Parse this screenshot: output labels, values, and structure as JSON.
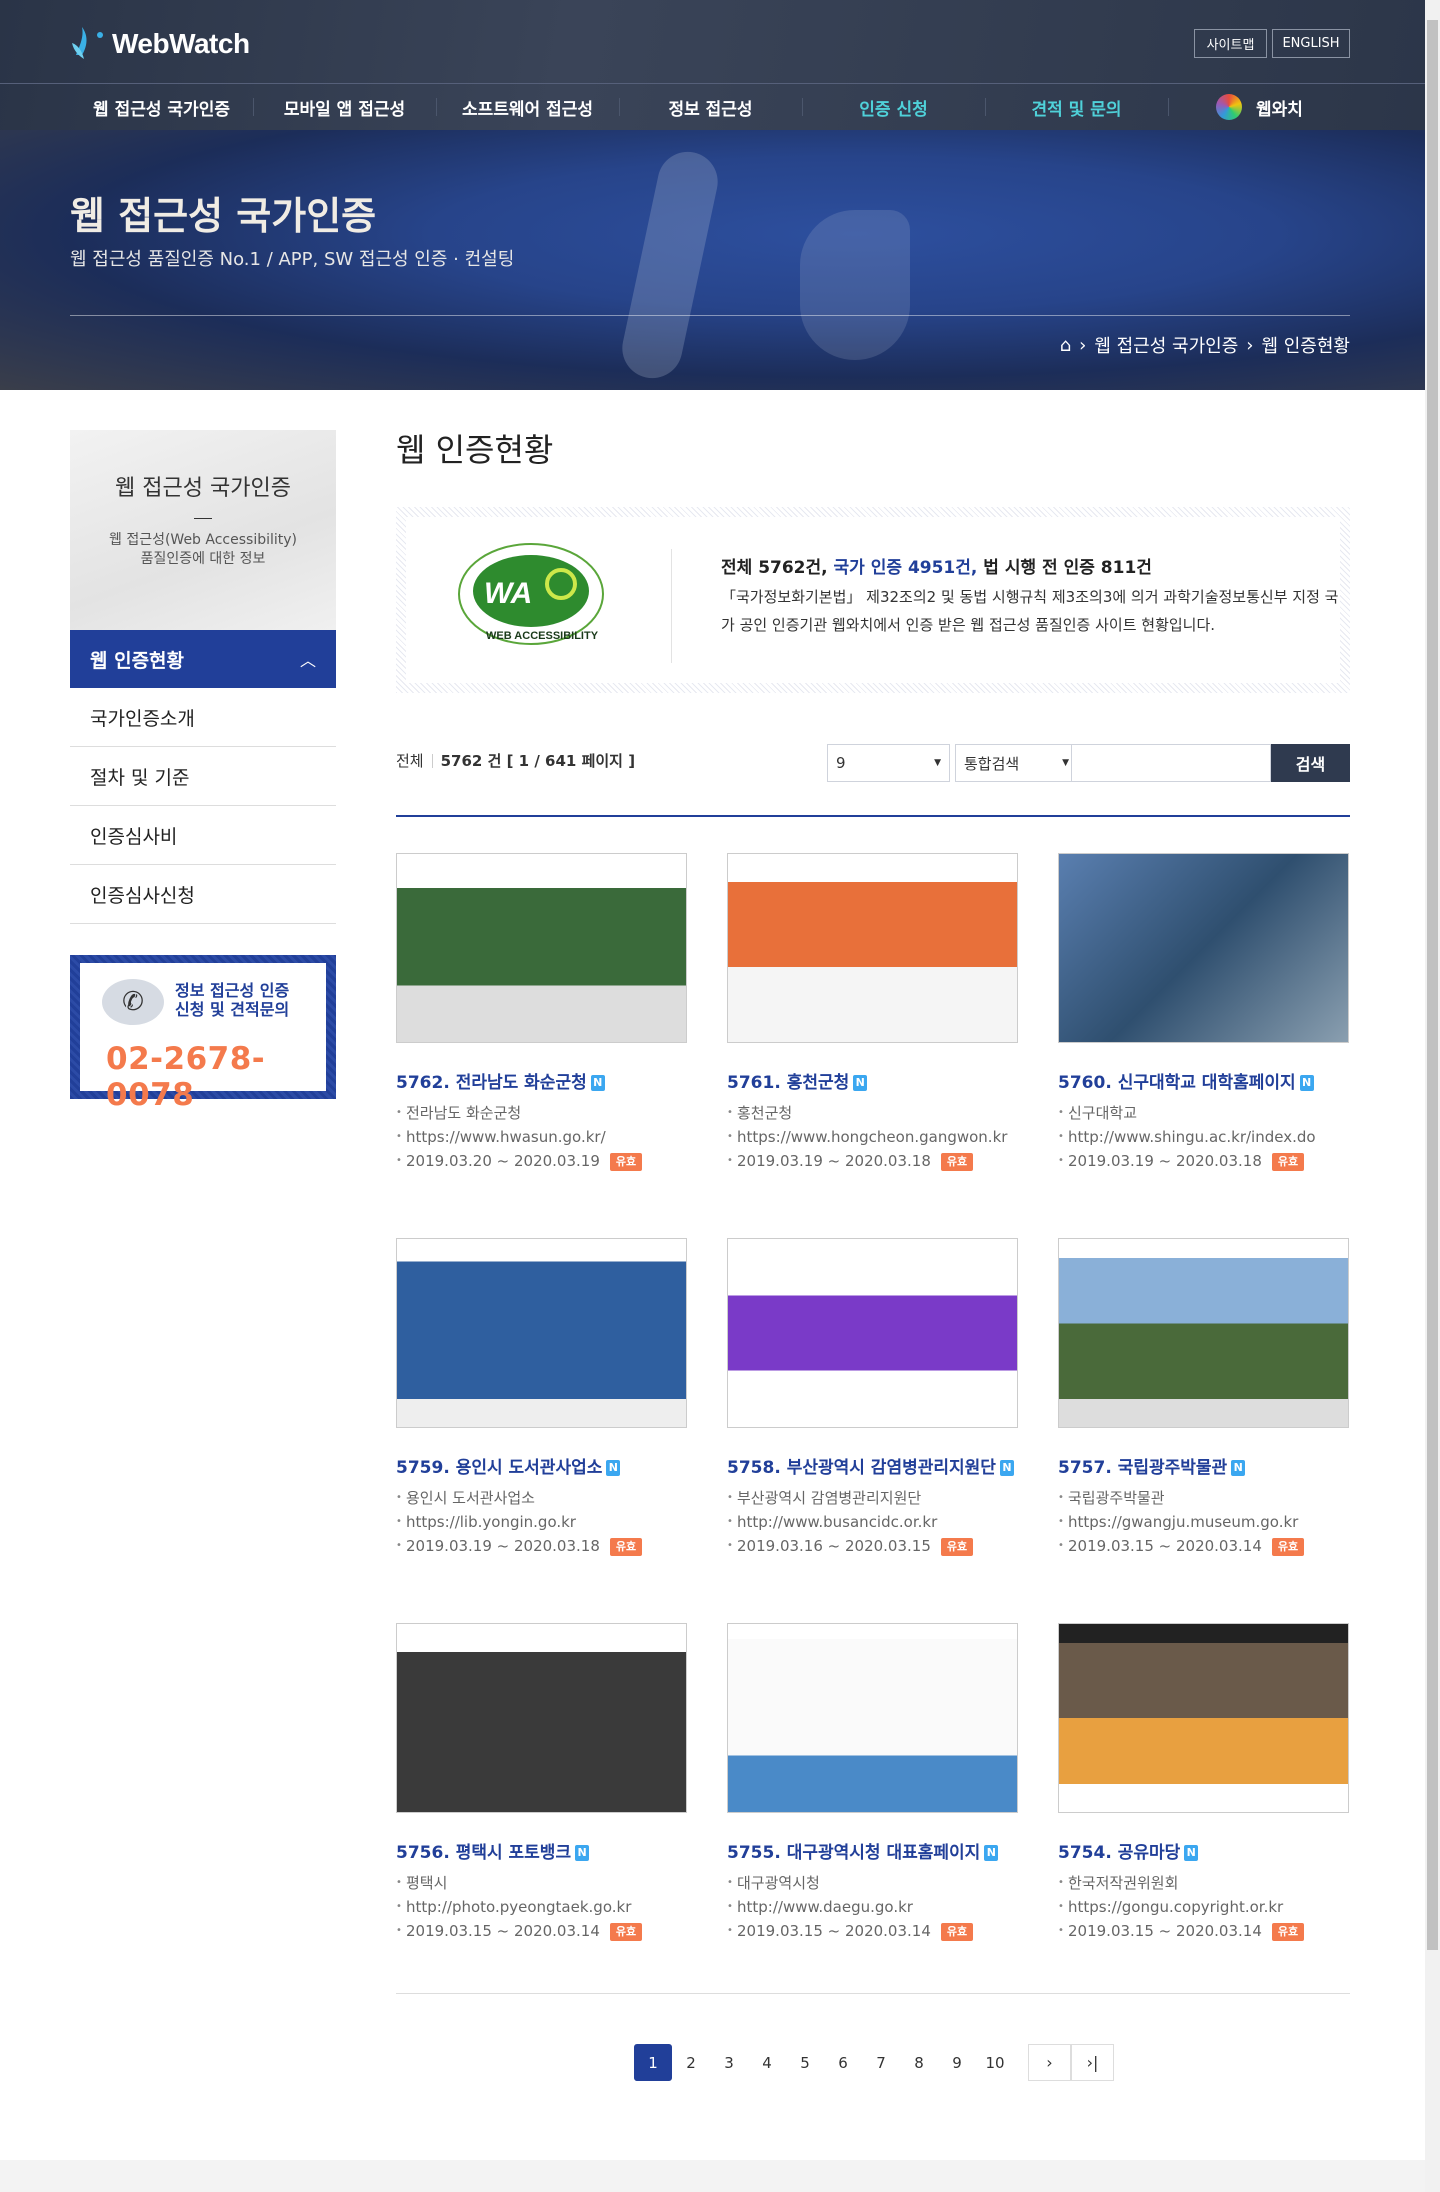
{
  "header": {
    "logo": "WebWatch",
    "sitemap": "사이트맵",
    "english": "ENGLISH",
    "nav": [
      "웹 접근성 국가인증",
      "모바일 앱 접근성",
      "소프트웨어 접근성",
      "정보 접근성",
      "인증 신청",
      "견적 및 문의",
      "웹와치"
    ]
  },
  "hero": {
    "title": "웹 접근성 국가인증",
    "subtitle": "웹 접근성 품질인증 No.1 / APP, SW 접근성 인증 · 컨설팅",
    "breadcrumb": [
      "웹 접근성 국가인증",
      "웹 인증현황"
    ]
  },
  "sidebar": {
    "title": "웹 접근성 국가인증",
    "desc1": "웹 접근성(Web Accessibility)",
    "desc2": "품질인증에 대한 정보",
    "active": "웹 인증현황",
    "items": [
      "국가인증소개",
      "절차 및 기준",
      "인증심사비",
      "인증심사신청"
    ],
    "contact": {
      "line1": "정보 접근성 인증",
      "line2": "신청 및 견적문의",
      "phone": "02-2678-0078"
    }
  },
  "main": {
    "title": "웹 인증현황",
    "info": {
      "total": "전체 5762건,",
      "national": "국가 인증 4951건,",
      "pre": "법 시행 전 인증 811건",
      "desc": "「국가정보화기본법」 제32조의2 및 동법 시행규칙 제3조의3에 의거 과학기술정보통신부 지정 국가 공인 인증기관 웹와치에서 인증 받은 웹 접근성 품질인증 사이트 현황입니다.",
      "logo_text": "WEB ACCESSIBILITY"
    },
    "count": {
      "label": "전체",
      "value": "5762 건 [ 1 / 641 페이지 ]"
    },
    "search": {
      "per_page": "9",
      "type": "통합검색",
      "query": "",
      "button": "검색"
    },
    "new_badge": "N",
    "valid_badge": "유효",
    "cards": [
      {
        "title": "5762. 전라남도 화순군청",
        "org": "전라남도 화순군청",
        "url": "https://www.hwasun.go.kr/",
        "period": "2019.03.20 ~ 2020.03.19"
      },
      {
        "title": "5761. 홍천군청",
        "org": "홍천군청",
        "url": "https://www.hongcheon.gangwon.kr",
        "period": "2019.03.19 ~ 2020.03.18"
      },
      {
        "title": "5760. 신구대학교 대학홈페이지",
        "org": "신구대학교",
        "url": "http://www.shingu.ac.kr/index.do",
        "period": "2019.03.19 ~ 2020.03.18"
      },
      {
        "title": "5759. 용인시 도서관사업소",
        "org": "용인시 도서관사업소",
        "url": "https://lib.yongin.go.kr",
        "period": "2019.03.19 ~ 2020.03.18"
      },
      {
        "title": "5758. 부산광역시 감염병관리지원단",
        "org": "부산광역시 감염병관리지원단",
        "url": "http://www.busancidc.or.kr",
        "period": "2019.03.16 ~ 2020.03.15"
      },
      {
        "title": "5757. 국립광주박물관",
        "org": "국립광주박물관",
        "url": "https://gwangju.museum.go.kr",
        "period": "2019.03.15 ~ 2020.03.14"
      },
      {
        "title": "5756. 평택시 포토뱅크",
        "org": "평택시",
        "url": "http://photo.pyeongtaek.go.kr",
        "period": "2019.03.15 ~ 2020.03.14"
      },
      {
        "title": "5755. 대구광역시청 대표홈페이지",
        "org": "대구광역시청",
        "url": "http://www.daegu.go.kr",
        "period": "2019.03.15 ~ 2020.03.14"
      },
      {
        "title": "5754. 공유마당",
        "org": "한국저작권위원회",
        "url": "https://gongu.copyright.or.kr",
        "period": "2019.03.15 ~ 2020.03.14"
      }
    ],
    "pagination": {
      "pages": [
        "1",
        "2",
        "3",
        "4",
        "5",
        "6",
        "7",
        "8",
        "9",
        "10"
      ],
      "current": "1",
      "next": "›",
      "last": "›|"
    }
  },
  "colors": {
    "primary": "#213f99",
    "accent": "#f47a4c",
    "header": "#2f3a4f",
    "teal": "#4fd1d9"
  }
}
